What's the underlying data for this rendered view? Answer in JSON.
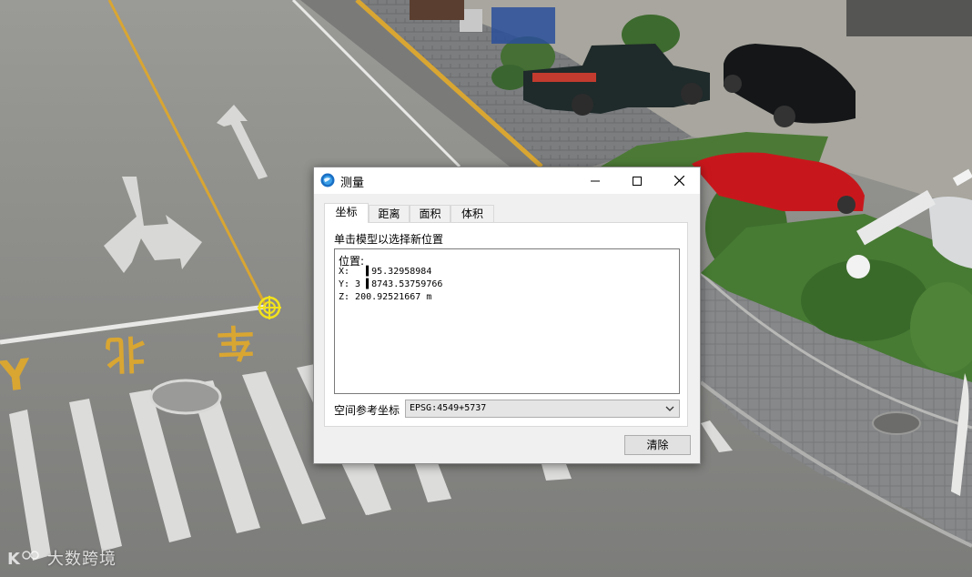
{
  "dialog": {
    "title": "测量",
    "tabs": [
      {
        "label": "坐标",
        "active": true
      },
      {
        "label": "距离",
        "active": false
      },
      {
        "label": "面积",
        "active": false
      },
      {
        "label": "体积",
        "active": false
      }
    ],
    "hint": "单击模型以选择新位置",
    "result": {
      "label": "位置:",
      "x_line": "X:   ▌95.32958984",
      "y_line": "Y: 3 ▌8743.53759766",
      "z_line": "Z: 200.92521667 m"
    },
    "srs_label": "空间参考坐标",
    "srs_value": "EPSG:4549+5737",
    "clear_label": "清除"
  },
  "scene": {
    "road_markings": [
      "Y",
      "北",
      "车"
    ],
    "picked_point_icon": "crosshair-target-icon"
  },
  "watermark": {
    "text": "大数跨境"
  },
  "colors": {
    "road": "#8c8c88",
    "lane_yellow": "#d9a632",
    "picker_yellow": "#f2e21a",
    "dialog_bg": "#f0f0f0"
  }
}
